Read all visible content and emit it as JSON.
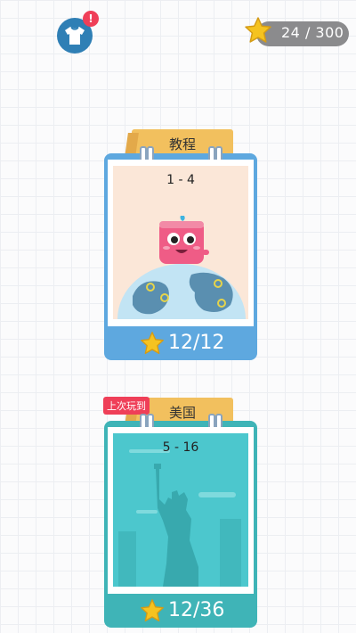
{
  "top_bar": {
    "shirt_icon": "tshirt-icon",
    "notification_badge": "!",
    "star_total": "24 / 300"
  },
  "levels": [
    {
      "title": "教程",
      "range": "1 - 4",
      "progress": "12/12",
      "accent": "#5ea8df",
      "tag": ""
    },
    {
      "title": "美国",
      "range": "5 - 16",
      "progress": "12/36",
      "accent": "#3fb4b7",
      "tag": "上次玩到"
    }
  ],
  "colors": {
    "tab": "#f2c05e",
    "star": "#f5c320",
    "badge": "#ef3f58"
  }
}
